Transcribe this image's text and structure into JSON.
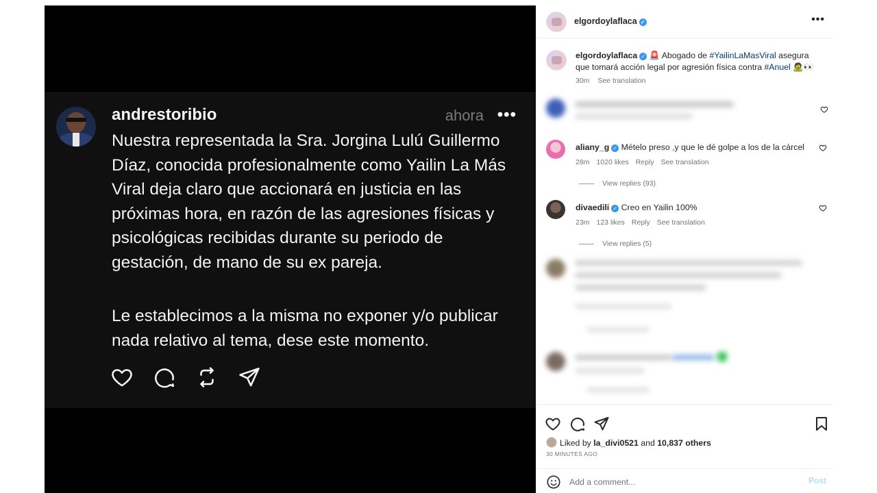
{
  "thread_post": {
    "username": "andrestoribio",
    "time": "ahora",
    "more_label": "•••",
    "paragraph1": "Nuestra representada la Sra. Jorgina Lulú Guillermo Díaz, conocida profesionalmente como Yailin La Más Viral deja claro que accionará en justicia en las próximas hora, en razón de las agresiones físicas y psicológicas recibidas durante su periodo de gestación, de mano de su ex pareja.",
    "paragraph2": "Le establecimos a la misma no exponer y/o publicar nada relativo al tema, dese este momento.",
    "actions": [
      "heart-icon",
      "comment-icon",
      "repost-icon",
      "share-icon"
    ]
  },
  "header": {
    "username": "elgordoylaflaca",
    "more_label": "•••"
  },
  "caption": {
    "username": "elgordoylaflaca",
    "text_before": "🚨 Abogado de ",
    "hashtag1": "#YailinLaMasViral",
    "text_middle": " asegura que tomará acción legal por agresión física contra ",
    "hashtag2": "#Anuel",
    "text_after": " 🧟👀",
    "time": "30m",
    "see_translation": "See translation"
  },
  "comments": [
    {
      "username": "aliany_g",
      "verified": true,
      "text": "Mételo preso ,y que le dé golpe a los de la cárcel",
      "time": "28m",
      "likes": "1020 likes",
      "reply": "Reply",
      "see_translation": "See translation",
      "view_replies": "View replies (93)"
    },
    {
      "username": "divaedili",
      "verified": true,
      "text": "Creo en Yailin 100%",
      "time": "23m",
      "likes": "123 likes",
      "reply": "Reply",
      "see_translation": "See translation",
      "view_replies": "View replies (5)"
    }
  ],
  "likes": {
    "prefix": "Liked by ",
    "user": "la_divi0521",
    "middle": " and ",
    "count": "10,837 others"
  },
  "time_ago": "30 MINUTES AGO",
  "add_comment": {
    "placeholder": "Add a comment...",
    "post_label": "Post"
  },
  "colors": {
    "verified": "#3897f0",
    "hashtag": "#00376b",
    "thread_bg": "#101010"
  }
}
